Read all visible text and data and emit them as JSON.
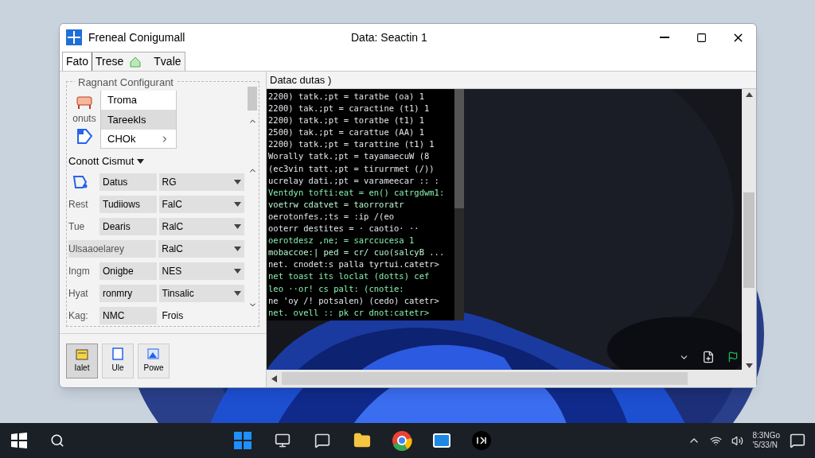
{
  "window": {
    "app_title": "Freneal Conigumall",
    "title": "Data: Seactin 1"
  },
  "tabs": [
    {
      "label": "Fato",
      "selected": true,
      "kind": "text"
    },
    {
      "label": "Trese",
      "selected": false,
      "kind": "text"
    },
    {
      "label": "Tvale",
      "selected": false,
      "kind": "icon"
    }
  ],
  "left_panel": {
    "group_title": "Ragnant Configurant",
    "side_label": "onuts",
    "list": [
      {
        "label": "Troma",
        "selected": false
      },
      {
        "label": "Tareekls",
        "selected": true
      },
      {
        "label": "CHOk",
        "selected": false
      }
    ],
    "section_title": "Conott Cismut",
    "rows": [
      {
        "label": "",
        "field": "Datus",
        "value": "RG",
        "kind": "dropdown"
      },
      {
        "label": "Rest",
        "field": "Tudiiows",
        "value": "FalC",
        "kind": "dropdown"
      },
      {
        "label": "Tue",
        "field": "Dearis",
        "value": "RalC",
        "kind": "dropdown"
      },
      {
        "label": "Ulsaaoelarey",
        "field": "",
        "value": "RalC",
        "kind": "dropdown"
      },
      {
        "label": "Ingm",
        "field": "Onigbe",
        "value": "NES",
        "kind": "dropdown"
      },
      {
        "label": "Hyat",
        "field": "ronmry",
        "value": "Tinsalic",
        "kind": "dropdown"
      },
      {
        "label": "Kag:",
        "field": "NMC",
        "value": "Frois",
        "kind": "plain"
      }
    ],
    "buttons": [
      {
        "label": "Ialet",
        "selected": true
      },
      {
        "label": "Ule",
        "selected": false
      },
      {
        "label": "Powe",
        "selected": false
      }
    ]
  },
  "right_panel": {
    "title": "Datac dutas )",
    "lines": [
      {
        "text": "2200) tatk.;pt = taratbe (oa) 1",
        "color": "#e5e7eb"
      },
      {
        "text": "2200) tak.;pt = caractine (t1) 1",
        "color": "#e5e7eb"
      },
      {
        "text": "2200) tatk.;pt = toratbe (t1) 1",
        "color": "#e5e7eb"
      },
      {
        "text": "2500) tak.;pt = carattue (AA) 1",
        "color": "#e5e7eb"
      },
      {
        "text": "2200) tatk.;pt = tarattine (t1) 1",
        "color": "#e5e7eb"
      },
      {
        "text": "Worally tatk.;pt = tayamaecuW (8",
        "color": "#e5e7eb"
      },
      {
        "text": "(ec3vin tatt.;pt = tirurrmet (/))",
        "color": "#e5e7eb"
      },
      {
        "text": "ucrelay dati.;pt = varameecar :: :",
        "color": "#e5e7eb"
      },
      {
        "text": "Ventdyn tofti:eat = en() catrgdwm1:",
        "color": "#86efac"
      },
      {
        "text": "voetrw cdatvet = taorroratr",
        "color": "#bbf7d0"
      },
      {
        "text": "oerotonfes.;ts = :ip /(eo",
        "color": "#e5e7eb"
      },
      {
        "text": "ooterr destites = · caotio· ··",
        "color": "#e5e7eb"
      },
      {
        "text": "oerotdesz ,ne; = sarccucesa 1",
        "color": "#86efac"
      },
      {
        "text": "mobaccoe:| ped = cr/ cuo(salcyB ...",
        "color": "#bbf7d0"
      },
      {
        "text": "net. cnodet:s palla tyrtui.catetr>",
        "color": "#e5e7eb"
      },
      {
        "text": "net toast its loclat (dotts) cef",
        "color": "#86efac"
      },
      {
        "text": "leo ··or! cs palt: (cnotie:",
        "color": "#86efac"
      },
      {
        "text": "ne 'oy /! potsalen) (cedo) catetr>",
        "color": "#e5e7eb"
      },
      {
        "text": "net. ovell :: pk cr dnot:catetr>",
        "color": "#86efac"
      }
    ]
  },
  "taskbar": {
    "clock_time": "8:3NGo",
    "clock_date": "'5/33/N"
  }
}
